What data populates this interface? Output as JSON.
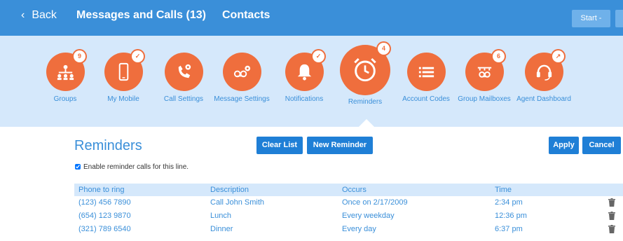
{
  "header": {
    "back_label": "Back",
    "back_chevron": "‹",
    "title": "Messages and Calls (13)",
    "contacts_label": "Contacts",
    "start_label": "Start -",
    "bg_color": "#3a8fd9"
  },
  "icons": [
    {
      "label": "Groups",
      "badge": "9",
      "icon": "groups-icon"
    },
    {
      "label": "My Mobile",
      "badge": "✓",
      "icon": "mobile-icon"
    },
    {
      "label": "Call Settings",
      "badge": "",
      "icon": "call-settings-icon"
    },
    {
      "label": "Message Settings",
      "badge": "",
      "icon": "voicemail-settings-icon"
    },
    {
      "label": "Notifications",
      "badge": "✓",
      "icon": "bell-icon"
    },
    {
      "label": "Reminders",
      "badge": "4",
      "icon": "alarm-clock-icon",
      "selected": true
    },
    {
      "label": "Account Codes",
      "badge": "",
      "icon": "list-icon"
    },
    {
      "label": "Group Mailboxes",
      "badge": "6",
      "icon": "group-mailbox-icon"
    },
    {
      "label": "Agent Dashboard",
      "badge": "↗",
      "icon": "headset-icon"
    }
  ],
  "main": {
    "heading": "Reminders",
    "clear_list_label": "Clear List",
    "new_reminder_label": "New Reminder",
    "apply_label": "Apply",
    "cancel_label": "Cancel",
    "enable_checkbox_label": "Enable reminder calls for this line.",
    "enable_checked": true
  },
  "table": {
    "columns": [
      "Phone to ring",
      "Description",
      "Occurs",
      "Time"
    ],
    "rows": [
      [
        "(123) 456 7890",
        "Call John Smith",
        "Once on 2/17/2009",
        "2:34 pm"
      ],
      [
        "(654) 123 9870",
        "Lunch",
        "Every weekday",
        "12:36 pm"
      ],
      [
        "(321) 789 6540",
        "Dinner",
        "Every day",
        "6:37 pm"
      ]
    ]
  },
  "colors": {
    "accent": "#3a8fd9",
    "icon_orange": "#ef6e3d",
    "panel_bg": "#d5e8fb",
    "button_blue": "#1f7fd6"
  }
}
